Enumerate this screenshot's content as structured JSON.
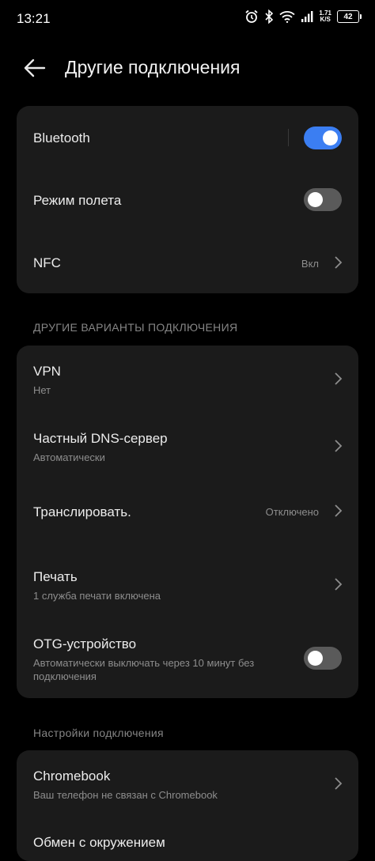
{
  "status": {
    "time": "13:21",
    "speed_top": "1.71",
    "speed_bottom": "K/S",
    "battery": "42"
  },
  "header": {
    "title": "Другие подключения"
  },
  "card1": {
    "bluetooth": {
      "label": "Bluetooth",
      "state": "on"
    },
    "airplane": {
      "label": "Режим полета",
      "state": "off"
    },
    "nfc": {
      "label": "NFC",
      "value": "Вкл"
    }
  },
  "section1": "ДРУГИЕ ВАРИАНТЫ ПОДКЛЮЧЕНИЯ",
  "card2": {
    "vpn": {
      "label": "VPN",
      "sub": "Нет"
    },
    "dns": {
      "label": "Частный DNS-сервер",
      "sub": "Автоматически"
    },
    "cast": {
      "label": "Транслировать.",
      "value": "Отключено"
    },
    "print": {
      "label": "Печать",
      "sub": "1 служба печати включена"
    },
    "otg": {
      "label": "OTG-устройство",
      "sub": "Автоматически выключать через 10 минут без подключения",
      "state": "off"
    }
  },
  "section2": "Настройки подключения",
  "card3": {
    "chromebook": {
      "label": "Chromebook",
      "sub": "Ваш телефон не связан с Chromebook"
    },
    "share": {
      "label": "Обмен с окружением"
    }
  },
  "colors": {
    "accent": "#3b7ef2",
    "card": "#1b1b1b",
    "background": "#000000"
  }
}
